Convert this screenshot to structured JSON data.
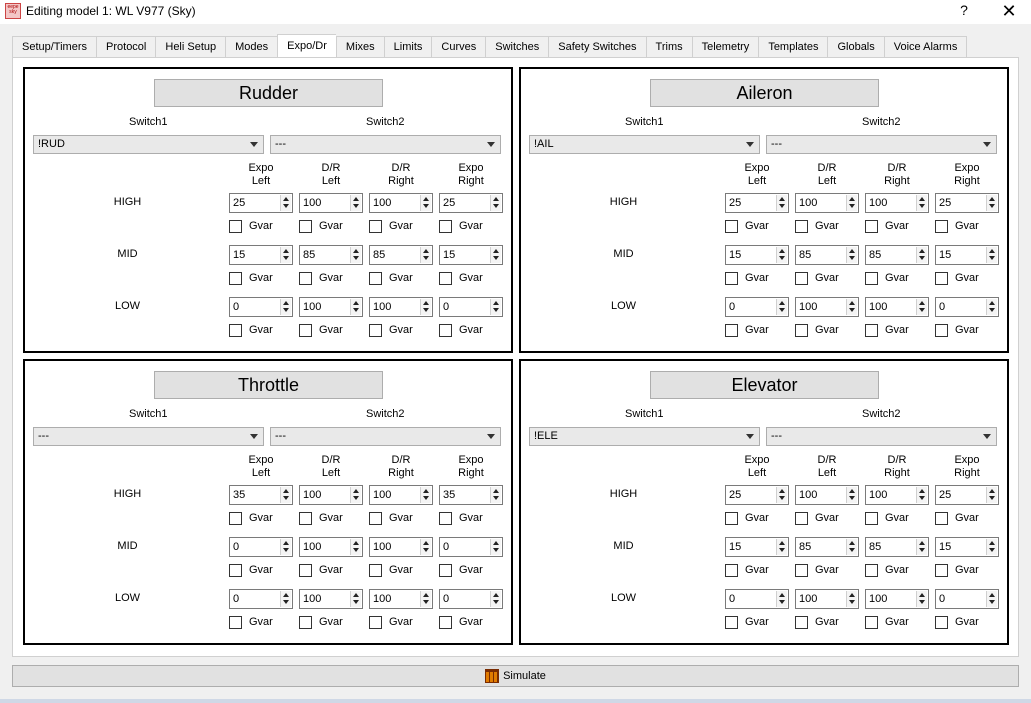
{
  "window": {
    "title": "Editing model 1: WL V977 (Sky)",
    "icon_label": "eepe\nsky",
    "help_label": "?",
    "close_label": "✕"
  },
  "tabs": [
    "Setup/Timers",
    "Protocol",
    "Heli Setup",
    "Modes",
    "Expo/Dr",
    "Mixes",
    "Limits",
    "Curves",
    "Switches",
    "Safety Switches",
    "Trims",
    "Telemetry",
    "Templates",
    "Globals",
    "Voice Alarms"
  ],
  "active_tab": "Expo/Dr",
  "labels": {
    "switch1": "Switch1",
    "switch2": "Switch2",
    "col_expo_left": "Expo\nLeft",
    "col_dr_left": "D/R\nLeft",
    "col_dr_right": "D/R\nRight",
    "col_expo_right": "Expo\nRight",
    "row_high": "HIGH",
    "row_mid": "MID",
    "row_low": "LOW",
    "gvar": "Gvar"
  },
  "panels": [
    {
      "key": "rudder",
      "title": "Rudder",
      "switch1": "!RUD",
      "switch2": "---",
      "rows": [
        [
          "25",
          "100",
          "100",
          "25"
        ],
        [
          "15",
          "85",
          "85",
          "15"
        ],
        [
          "0",
          "100",
          "100",
          "0"
        ]
      ]
    },
    {
      "key": "aileron",
      "title": "Aileron",
      "switch1": "!AIL",
      "switch2": "---",
      "rows": [
        [
          "25",
          "100",
          "100",
          "25"
        ],
        [
          "15",
          "85",
          "85",
          "15"
        ],
        [
          "0",
          "100",
          "100",
          "0"
        ]
      ]
    },
    {
      "key": "throttle",
      "title": "Throttle",
      "switch1": "---",
      "switch2": "---",
      "rows": [
        [
          "35",
          "100",
          "100",
          "35"
        ],
        [
          "0",
          "100",
          "100",
          "0"
        ],
        [
          "0",
          "100",
          "100",
          "0"
        ]
      ]
    },
    {
      "key": "elevator",
      "title": "Elevator",
      "switch1": "!ELE",
      "switch2": "---",
      "rows": [
        [
          "25",
          "100",
          "100",
          "25"
        ],
        [
          "15",
          "85",
          "85",
          "15"
        ],
        [
          "0",
          "100",
          "100",
          "0"
        ]
      ]
    }
  ],
  "footer": {
    "simulate_label": "Simulate",
    "simulate_icon": "simulate-icon"
  }
}
